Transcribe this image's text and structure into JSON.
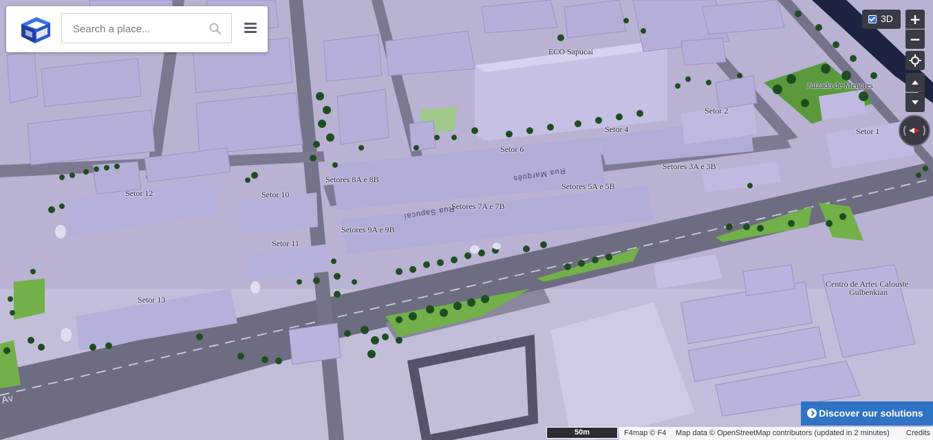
{
  "search": {
    "placeholder": "Search a place..."
  },
  "controls": {
    "toggle_3d_label": "3D",
    "toggle_3d_checked": true,
    "zoom_in_label": "+",
    "zoom_out_label": "−",
    "locate_icon": "crosshair-icon",
    "tilt_up_icon": "triangle-up-icon",
    "tilt_down_icon": "triangle-down-icon",
    "compass_icon": "compass-needle-icon"
  },
  "map_labels": {
    "eco_sapucai": "ECO Sapucaí",
    "juizado": "Juizado de Menores",
    "setor_2": "Setor 2",
    "setor_1": "Setor 1",
    "setor_4": "Setor 4",
    "setor_6": "Setor 6",
    "setores_3a_3b": "Setores 3A e 3B",
    "setores_8a_8b": "Setores 8A e 8B",
    "setores_5a_5b": "Setores 5A e 5B",
    "setor_12": "Setor 12",
    "setor_10": "Setor 10",
    "setores_7a_7b": "Setores 7A e 7B",
    "setores_9a_9b": "Setores 9A e 9B",
    "setor_11": "Setor 11",
    "setor_13": "Setor 13",
    "centro_line1": "Centro de Artes Calouste",
    "centro_line2": "Gulbenkian"
  },
  "street_labels": {
    "rua_marques": "Rua Marquês",
    "rua_sapucai": "Rua Sapucaí",
    "av": "Av"
  },
  "footer": {
    "discover_label": "Discover our solutions",
    "scale_label": "50m",
    "f4map_credit": "F4map © F4",
    "map_data_credit": "Map data © OpenStreetMap contributors (updated in 2 minutes)",
    "credits_link": "Credits"
  },
  "colors": {
    "building": "#a8a2d0",
    "ground": "#b7b0cf",
    "road": "#6f6d82",
    "grass": "#6fae4a",
    "tree": "#1e4a1e",
    "control_bg": "#3a3a44",
    "discover_bg": "#2f73c5"
  }
}
